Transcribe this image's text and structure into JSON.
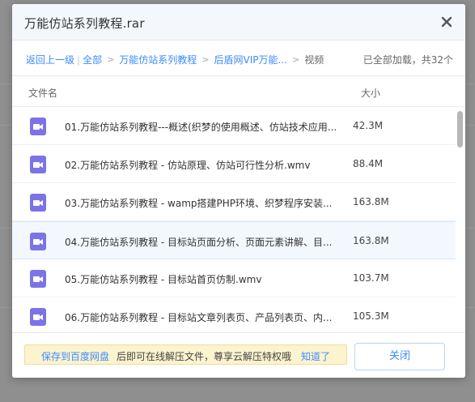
{
  "dialog": {
    "title": "万能仿站系列教程.rar"
  },
  "breadcrumb": {
    "back": "返回上一级",
    "all": "全部",
    "level1": "万能仿站系列教程",
    "level2": "后盾网VIP万能...",
    "current": "视频",
    "status": "已全部加载，共32个"
  },
  "list": {
    "col_name": "文件名",
    "col_size": "大小",
    "files": [
      {
        "name": "01.万能仿站系列教程---概述(织梦的使用概述、仿站技术应用...",
        "size": "42.3M"
      },
      {
        "name": "02.万能仿站系列教程 - 仿站原理、仿站可行性分析.wmv",
        "size": "88.4M"
      },
      {
        "name": "03.万能仿站系列教程 - wamp搭建PHP环境、织梦程序安装...",
        "size": "163.8M"
      },
      {
        "name": "04.万能仿站系列教程 - 目标站页面分析、页面元素讲解、目...",
        "size": "163.8M"
      },
      {
        "name": "05.万能仿站系列教程 - 目标站首页仿制.wmv",
        "size": "103.7M"
      },
      {
        "name": "06.万能仿站系列教程 - 目标站文章列表页、产品列表页、内...",
        "size": "105.3M"
      }
    ]
  },
  "footer": {
    "save_link": "保存到百度网盘",
    "notice": "后即可在线解压文件，尊享云解压特权哦",
    "ok_link": "知道了",
    "close_button": "关闭"
  },
  "colors": {
    "accent": "#3b8cff",
    "video_icon": "#7c73e6",
    "notice_bg": "#fcf3cf"
  }
}
